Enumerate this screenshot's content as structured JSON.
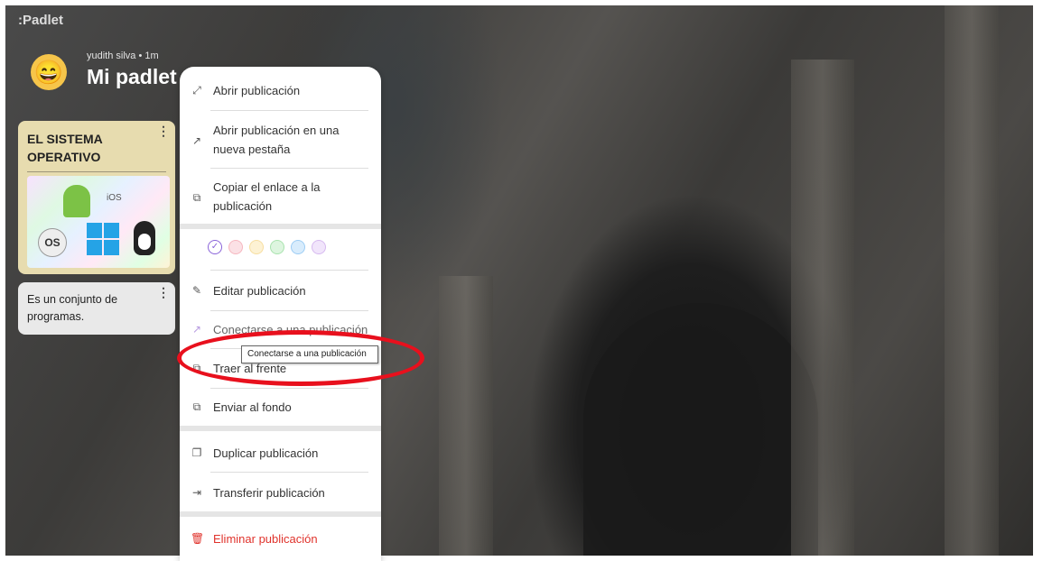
{
  "app": {
    "logo": ":Padlet"
  },
  "header": {
    "author_meta": "yudith silva • 1m",
    "title": "Mi padlet espectacular",
    "avatar_emoji": "😄"
  },
  "posts": [
    {
      "title": "EL SISTEMA OPERATIVO",
      "image_labels": {
        "ios": "iOS",
        "macos": "mac OS"
      }
    },
    {
      "body": "Es un conjunto de programas."
    }
  ],
  "context_menu": {
    "items": {
      "open": "Abrir publicación",
      "open_new_tab": "Abrir publicación en una nueva pestaña",
      "copy_link": "Copiar el enlace a la publicación",
      "edit": "Editar publicación",
      "connect": "Conectarse a una publicación",
      "bring_front": "Traer al frente",
      "send_back": "Enviar al fondo",
      "duplicate": "Duplicar publicación",
      "transfer": "Transferir publicación",
      "delete": "Eliminar publicación"
    },
    "colors": [
      "#c9b2f2",
      "#f6b6bf",
      "#f7dea0",
      "#a9e3ae",
      "#9dcdf4",
      "#d6b9ef"
    ],
    "selected_color": "#8a64d9",
    "delete_color": "#e0332c"
  },
  "tooltip": {
    "text": "Conectarse a una publicación"
  },
  "annotation": {
    "color": "#e8101d"
  }
}
